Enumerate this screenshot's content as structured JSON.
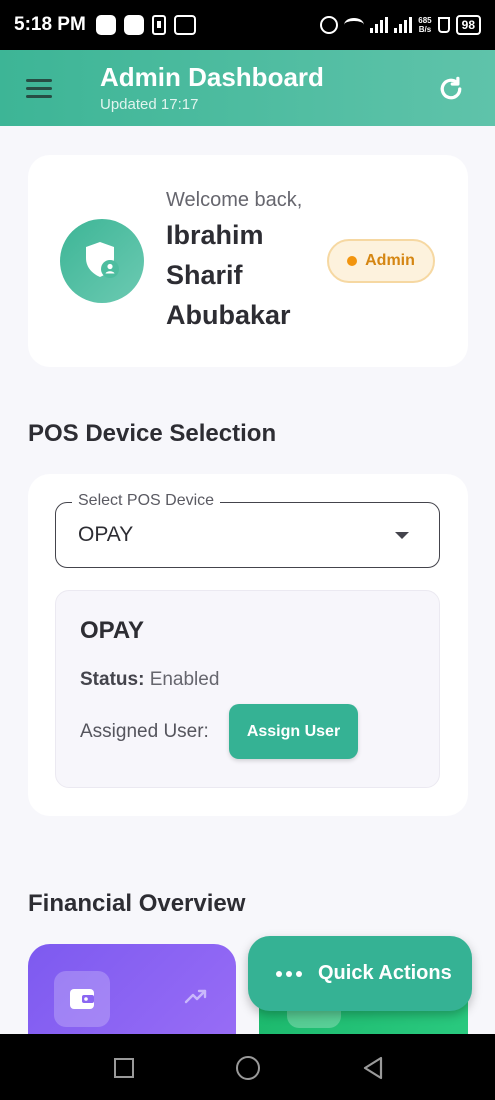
{
  "status_bar": {
    "time": "5:18 PM",
    "net_speed_top": "685",
    "net_speed_bottom": "B/s",
    "battery": "98"
  },
  "app_bar": {
    "title": "Admin Dashboard",
    "subtitle": "Updated 17:17"
  },
  "welcome": {
    "greeting": "Welcome back,",
    "name": "Ibrahim Sharif Abubakar",
    "role": "Admin"
  },
  "pos": {
    "section_title": "POS Device Selection",
    "select_label": "Select POS Device",
    "select_value": "OPAY",
    "device_name": "OPAY",
    "status_label": "Status:",
    "status_value": "Enabled",
    "assigned_label": "Assigned User:",
    "assign_button": "Assign User"
  },
  "financial": {
    "section_title": "Financial Overview"
  },
  "fab": {
    "label": "Quick Actions"
  },
  "colors": {
    "primary": "#35b294",
    "badge_text": "#d58612",
    "purple_card": "#7d5af0",
    "green_card": "#1bb76b"
  }
}
